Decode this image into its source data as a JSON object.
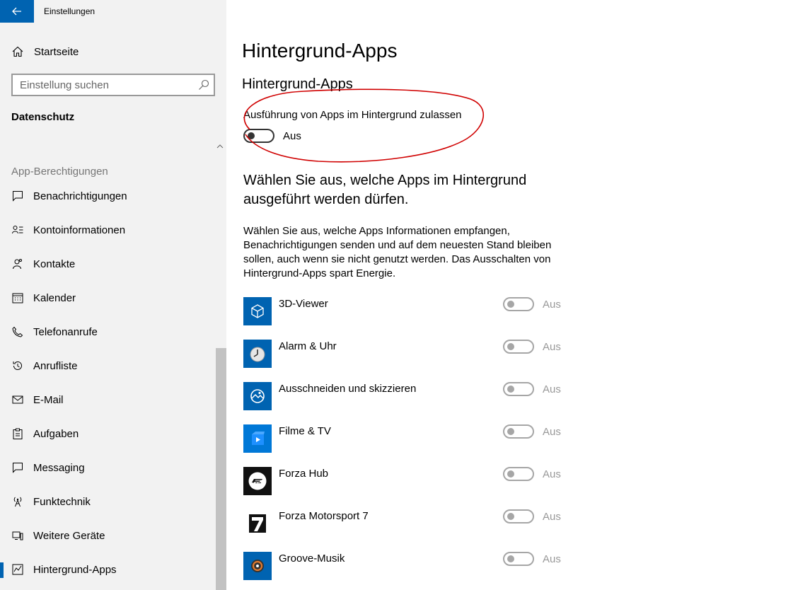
{
  "window": {
    "title": "Einstellungen"
  },
  "sidebar": {
    "home_label": "Startseite",
    "search_placeholder": "Einstellung suchen",
    "section_title": "Datenschutz",
    "group_header": "App-Berechtigungen",
    "items": [
      {
        "label": "Benachrichtigungen",
        "icon": "notification-icon"
      },
      {
        "label": "Kontoinformationen",
        "icon": "account-info-icon"
      },
      {
        "label": "Kontakte",
        "icon": "contacts-icon"
      },
      {
        "label": "Kalender",
        "icon": "calendar-icon"
      },
      {
        "label": "Telefonanrufe",
        "icon": "phone-icon"
      },
      {
        "label": "Anrufliste",
        "icon": "history-icon"
      },
      {
        "label": "E-Mail",
        "icon": "mail-icon"
      },
      {
        "label": "Aufgaben",
        "icon": "tasks-icon"
      },
      {
        "label": "Messaging",
        "icon": "message-icon"
      },
      {
        "label": "Funktechnik",
        "icon": "radio-icon"
      },
      {
        "label": "Weitere Geräte",
        "icon": "devices-icon"
      },
      {
        "label": "Hintergrund-Apps",
        "icon": "background-apps-icon",
        "active": true
      }
    ]
  },
  "main": {
    "page_title": "Hintergrund-Apps",
    "sub_title": "Hintergrund-Apps",
    "toggle_label": "Ausführung von Apps im Hintergrund zulassen",
    "toggle_state": "Aus",
    "heading": "Wählen Sie aus, welche Apps im Hintergrund ausgeführt werden dürfen.",
    "description": "Wählen Sie aus, welche Apps Informationen empfangen, Benachrichtigungen senden und auf dem neuesten Stand bleiben sollen, auch wenn sie nicht genutzt werden. Das Ausschalten von Hintergrund-Apps spart Energie.",
    "apps": [
      {
        "name": "3D-Viewer",
        "state": "Aus",
        "icon": "3d-viewer-icon"
      },
      {
        "name": "Alarm & Uhr",
        "state": "Aus",
        "icon": "alarm-clock-icon"
      },
      {
        "name": "Ausschneiden und skizzieren",
        "state": "Aus",
        "icon": "snip-sketch-icon"
      },
      {
        "name": "Filme & TV",
        "state": "Aus",
        "icon": "movies-tv-icon"
      },
      {
        "name": "Forza Hub",
        "state": "Aus",
        "icon": "forza-hub-icon"
      },
      {
        "name": "Forza Motorsport 7",
        "state": "Aus",
        "icon": "forza-7-icon"
      },
      {
        "name": "Groove-Musik",
        "state": "Aus",
        "icon": "groove-music-icon"
      }
    ]
  },
  "colors": {
    "accent": "#0063b1",
    "sidebar_bg": "#f2f2f2",
    "annotation": "#d00000"
  }
}
